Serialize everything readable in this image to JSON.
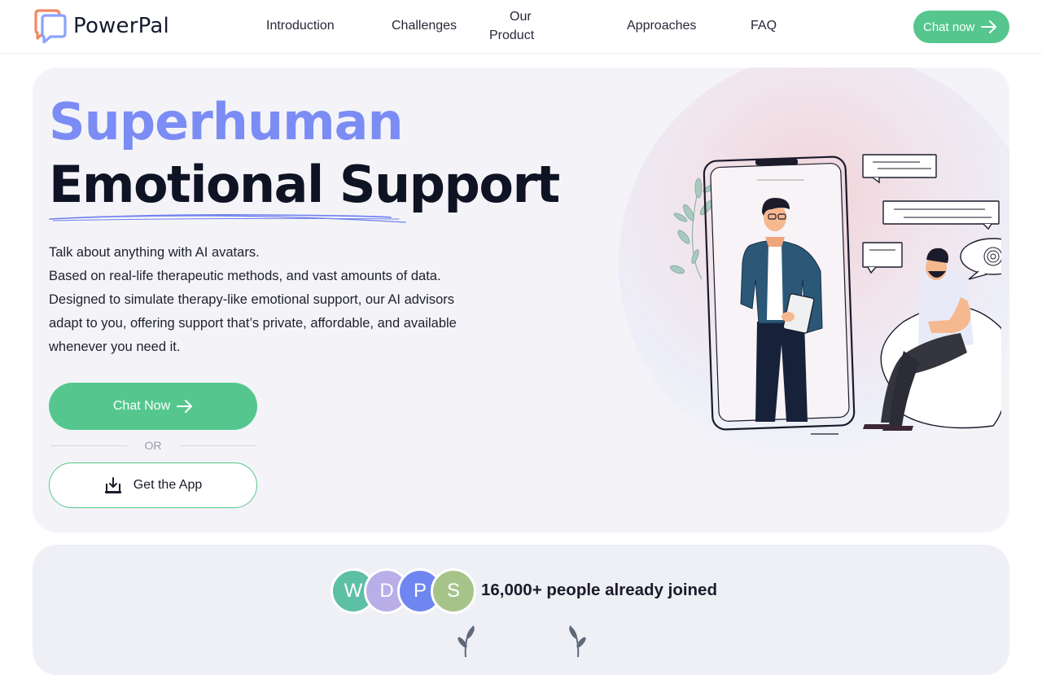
{
  "brand": {
    "name": "PowerPal",
    "colors": {
      "primary": "#55c78e",
      "accent": "#7b8cf5",
      "logo_orange": "#f08a63",
      "logo_blue": "#8aa2ff"
    },
    "logo_icon": "speech-bubble-logo-icon"
  },
  "nav": {
    "items": [
      {
        "label": "Introduction"
      },
      {
        "label": "Challenges"
      },
      {
        "label_line1": "Our",
        "label_line2": "Product"
      },
      {
        "label": "Approaches"
      },
      {
        "label": "FAQ"
      }
    ],
    "cta_label": "Chat now",
    "cta_icon": "arrow-right-icon"
  },
  "hero": {
    "title_line1": "Superhuman",
    "title_line2": "Emotional Support",
    "description": [
      "Talk about anything with AI avatars.",
      "Based on real-life therapeutic methods, and vast amounts of data.",
      "Designed to simulate therapy-like emotional support, our AI advisors",
      "adapt to you, offering support that’s private, affordable, and available",
      "whenever you need it."
    ],
    "primary_button": "Chat Now",
    "divider_text": "OR",
    "secondary_button": "Get the App",
    "secondary_icon": "download-icon",
    "illustration": "phone-avatar-therapy-illustration"
  },
  "proof": {
    "avatars": [
      {
        "initial": "W",
        "color": "#5dbfa3"
      },
      {
        "initial": "D",
        "color": "#b9aee8"
      },
      {
        "initial": "P",
        "color": "#6f86f0"
      },
      {
        "initial": "S",
        "color": "#a6c48a"
      }
    ],
    "joined_text": "16,000+ people already joined"
  }
}
